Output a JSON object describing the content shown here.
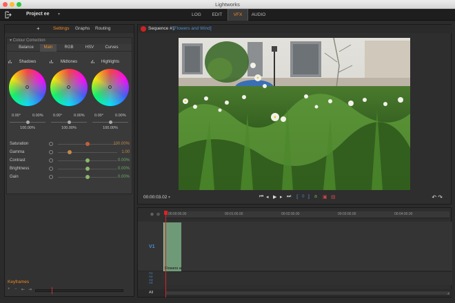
{
  "window": {
    "title": "Lightworks"
  },
  "topbar": {
    "project_name": "Project ee",
    "project_dropdown": "▾",
    "tabs": [
      {
        "label": "LOG",
        "active": false
      },
      {
        "label": "EDIT",
        "active": false
      },
      {
        "label": "VFX",
        "active": true
      },
      {
        "label": "AUDIO",
        "active": false
      }
    ]
  },
  "left_panel": {
    "add_label": "+",
    "tabs": [
      {
        "label": "Settings",
        "active": true
      },
      {
        "label": "Graphs",
        "active": false
      },
      {
        "label": "Routing",
        "active": false
      }
    ],
    "colour_correction": {
      "header": "▾ Colour Correction",
      "tabs": [
        {
          "label": "Balance",
          "active": false
        },
        {
          "label": "Main",
          "active": true
        },
        {
          "label": "RGB",
          "active": false
        },
        {
          "label": "HSV",
          "active": false
        },
        {
          "label": "Curves",
          "active": false
        }
      ],
      "wheels": [
        {
          "name": "Shadows",
          "angle": "0.00°",
          "amount": "0.00%",
          "level": "100.00%",
          "level_fraction": 0.5
        },
        {
          "name": "Midtones",
          "angle": "0.00°",
          "amount": "0.00%",
          "level": "100.00%",
          "level_fraction": 0.5
        },
        {
          "name": "Highlights",
          "angle": "0.00°",
          "amount": "0.00%",
          "level": "100.00%",
          "level_fraction": 0.5
        }
      ],
      "params": [
        {
          "label": "Saturation",
          "value": "100.00%",
          "fraction": 0.5,
          "knob_color": "#c0603a"
        },
        {
          "label": "Gamma",
          "value": "1.00",
          "fraction": 0.2,
          "knob_color": "#c08a4a"
        },
        {
          "label": "Contrast",
          "value": "0.00%",
          "fraction": 0.5,
          "knob_color": "#8ab86a"
        },
        {
          "label": "Brightness",
          "value": "0.00%",
          "fraction": 0.5,
          "knob_color": "#8ab86a"
        },
        {
          "label": "Gain",
          "value": "0.00%",
          "fraction": 0.5,
          "knob_color": "#8ab86a"
        }
      ]
    },
    "keyframes": {
      "label": "Keyframes",
      "controls": [
        "+",
        "−",
        "⇤",
        "⇥"
      ]
    }
  },
  "viewer": {
    "sequence_name": "Sequence #1",
    "sequence_clip": "[Flowers and Wind]",
    "timecode": "00:00:03.02",
    "timecode_dropdown": "▾",
    "transport": [
      "⏮",
      "◂",
      "▶",
      "▸",
      "⏭"
    ],
    "mark_icons": [
      "⟦",
      "◊",
      "⟧",
      "a"
    ],
    "right_controls": "↶ ↷"
  },
  "timeline": {
    "ruler": [
      "00:00:00.00",
      "00:01:00.00",
      "00:02:00.00",
      "00:03:00.00",
      "00:04:00.00"
    ],
    "video_track": "V1",
    "audio_tracks": [
      "A1",
      "A2",
      "A3",
      "A4"
    ],
    "all_label": "All",
    "clip_name": "Flowers and Wind",
    "accent": "#f08a24"
  }
}
